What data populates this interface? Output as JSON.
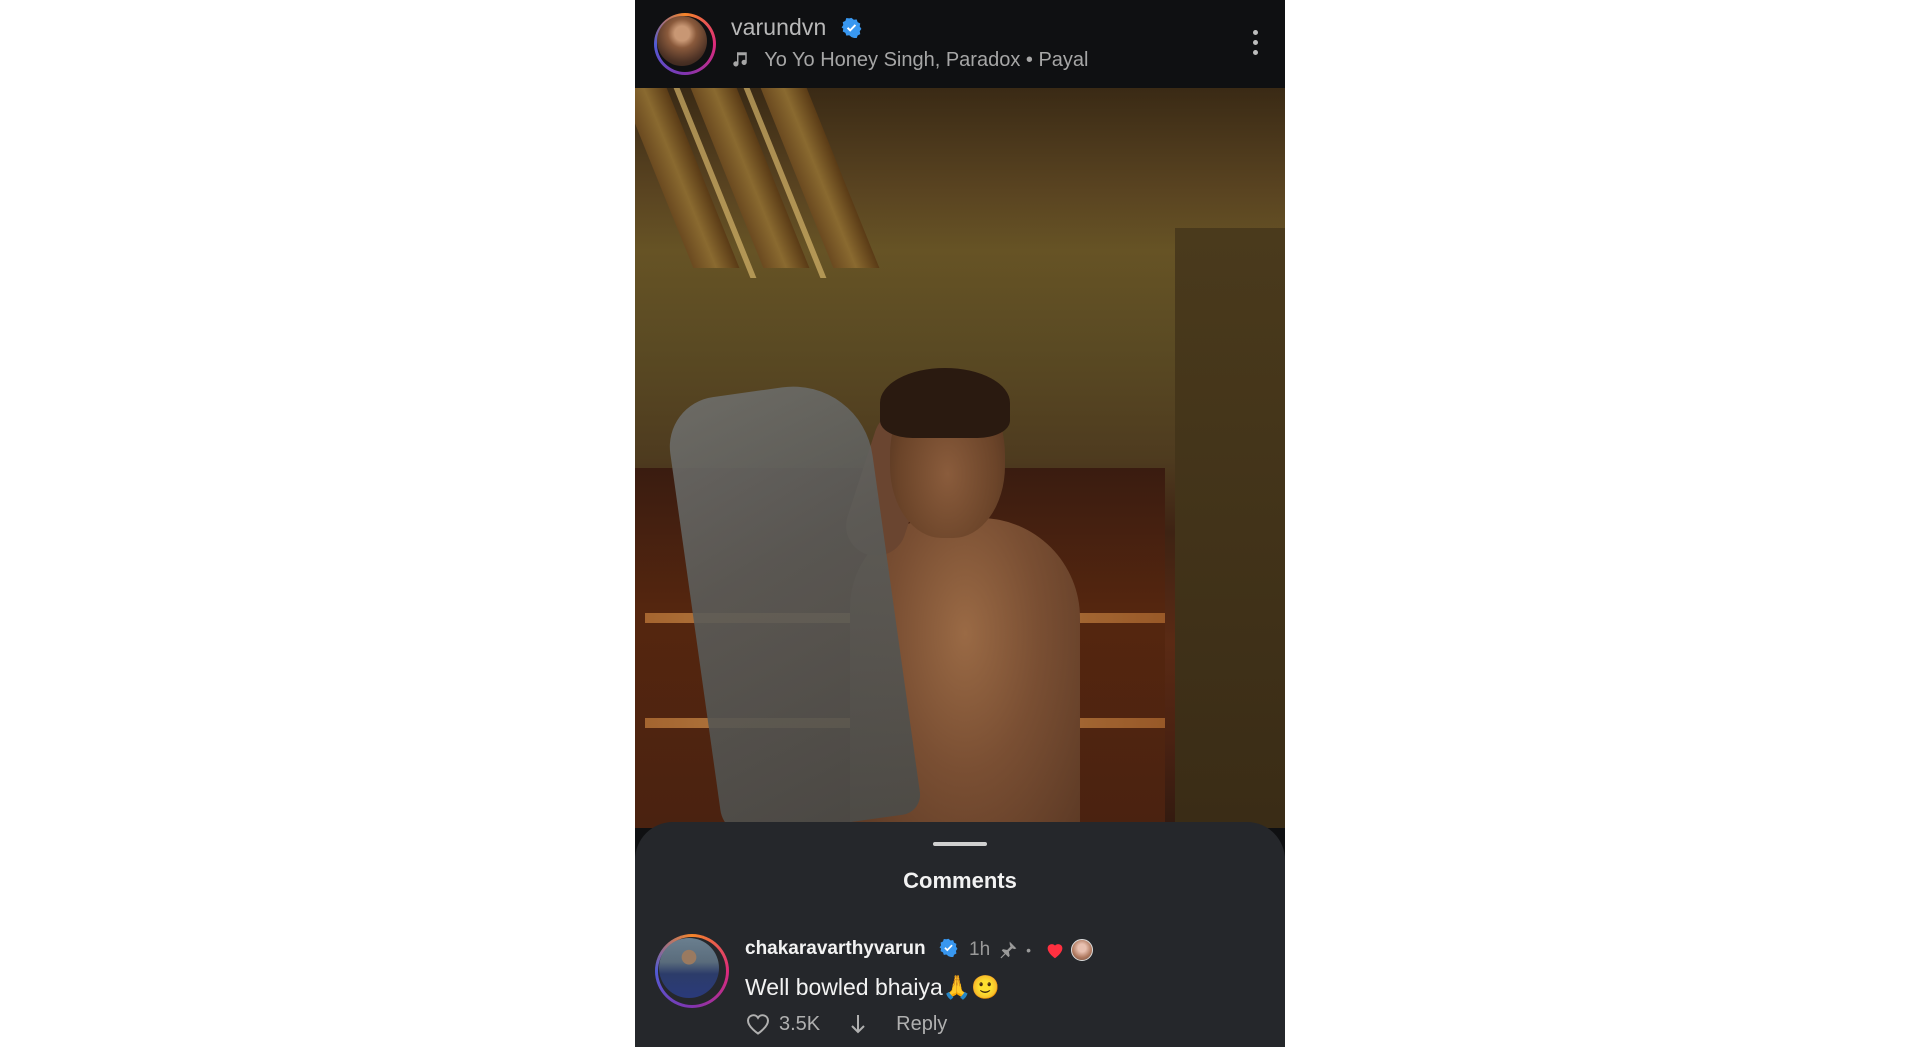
{
  "post": {
    "username": "varundvn",
    "music": "Yo Yo Honey Singh, Paradox • Payal"
  },
  "comments": {
    "title": "Comments",
    "items": [
      {
        "username": "chakaravarthyvarun",
        "time": "1h",
        "text": "Well bowled bhaiya🙏🙂",
        "likes": "3.5K",
        "reply_label": "Reply"
      }
    ]
  },
  "colors": {
    "verified": "#3897f0",
    "heart": "#ff3040"
  }
}
